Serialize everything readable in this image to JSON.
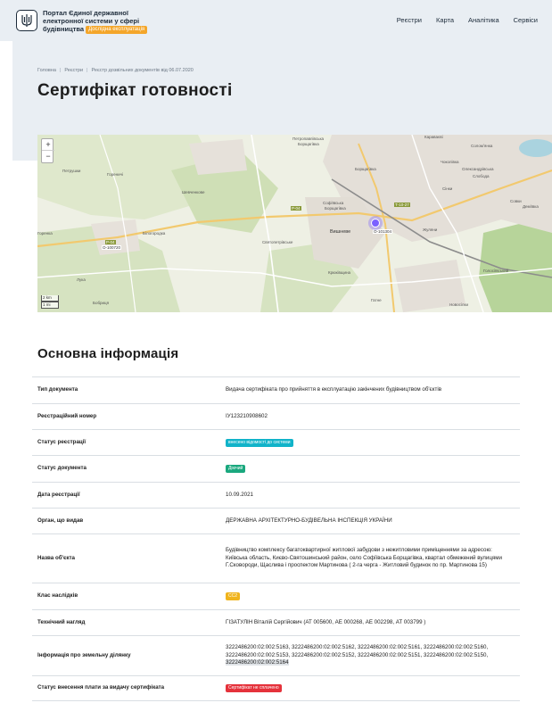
{
  "header": {
    "brand_line1": "Портал Єдиної державної",
    "brand_line2": "електронної системи у сфері",
    "brand_line3": "будівництва",
    "beta_label": "Дослідна експлуатація",
    "nav": [
      "Реєстри",
      "Карта",
      "Аналітика",
      "Сервіси"
    ]
  },
  "breadcrumb": [
    "Головна",
    "Реєстри",
    "Реєстр дозвільних документів від 06.07.2020"
  ],
  "page_title": "Сертифікат готовності",
  "map": {
    "zoom_in": "+",
    "zoom_out": "−",
    "scale_km": "2 km",
    "scale_mi": "1 mi",
    "labels": [
      {
        "t": "Петрушки"
      },
      {
        "t": "Горенка"
      },
      {
        "t": "Петропавлівська"
      },
      {
        "t": "Борщагівка"
      },
      {
        "t": "Шевченкове"
      },
      {
        "t": "Софіївська"
      },
      {
        "t": "Борщагівка"
      },
      {
        "t": "Вишневе"
      },
      {
        "t": "Святопетрівське"
      },
      {
        "t": "Білогородка"
      },
      {
        "t": "Гореничі"
      },
      {
        "t": "Лука"
      },
      {
        "t": "Бобриця"
      },
      {
        "t": "Жуляни"
      },
      {
        "t": "Крюківщина"
      },
      {
        "t": "Гатне"
      },
      {
        "t": "Караваєві"
      },
      {
        "t": "Чоколівка"
      },
      {
        "t": "Соломʼянка"
      },
      {
        "t": "Олександрівська"
      },
      {
        "t": "Слобода"
      },
      {
        "t": "Сінки"
      },
      {
        "t": "Деміївка"
      },
      {
        "t": "Голосіївський"
      },
      {
        "t": "Совки"
      },
      {
        "t": "Новосілки"
      },
      {
        "t": "Борщагівка"
      }
    ],
    "roads": [
      "P-04",
      "P-04",
      "Т-10-27",
      "О-101304",
      "О-100720"
    ]
  },
  "section_title": "Основна інформація",
  "info": [
    {
      "label": "Тип документа",
      "value": "Видача сертифіката про прийняття в експлуатацію закінчених будівництвом об'єктів"
    },
    {
      "label": "Реєстраційний номер",
      "value": "ІУ123210908602"
    },
    {
      "label": "Статус реєстрації",
      "badge": "внесено відомості до системи"
    },
    {
      "label": "Статус документа",
      "badge": "Діючий"
    },
    {
      "label": "Дата реєстрації",
      "value": "10.09.2021"
    },
    {
      "label": "Орган, що видав",
      "value": "ДЕРЖАВНА АРХІТЕКТУРНО-БУДІВЕЛЬНА ІНСПЕКЦІЯ УКРАЇНИ"
    },
    {
      "label": "Назва об'єкта",
      "value": "Будівництво комплексу багатоквартирної житлової забудови з нежитловими приміщеннями за адресою: Київська область, Києво-Святошинський район, село Софіївська Борщагівка, квартал обмежений вулицями Г.Сковороди, Щаслива і проспектом Мартинова ( 2-га черга - Житловий будинок по пр. Мартинова 15)"
    },
    {
      "label": "Клас наслідків",
      "badge": "СС2"
    },
    {
      "label": "Технічний нагляд",
      "value": "ГІЗАТУЛІН Віталій Сергійович (АТ 005600, АЕ 000268, АЕ 002298, АТ 003799 )"
    },
    {
      "label": "Інформація про земельну ділянку",
      "value_main": "3222486200:02:002:5163, 3222486200:02:002:5162, 3222486200:02:002:5161, 3222486200:02:002:5160, 3222486200:02:002:5153, 3222486200:02:002:5152, 3222486200:02:002:5151, 3222486200:02:002:5150,",
      "value_hl": "3222486200:02:002:5164"
    },
    {
      "label": "Статус внесення плати за видачу сертифіката",
      "badge": "Сертифікат не сплачено"
    }
  ],
  "colors": {
    "header_bg": "#e9eef3",
    "beta": "#f4a62a",
    "badge_cyan": "#11b3c9",
    "badge_teal": "#1aa87e",
    "badge_yellow": "#f0b41d",
    "badge_red": "#e5323b",
    "map_marker": "#7b61ff"
  }
}
